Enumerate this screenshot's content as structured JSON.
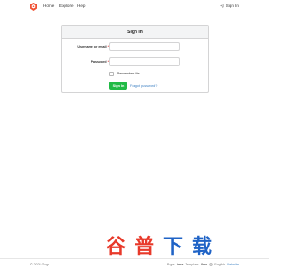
{
  "navbar": {
    "links": [
      "Home",
      "Explore",
      "Help"
    ],
    "signin": "Sign In",
    "logo_icon": "gogs-logo",
    "signin_icon": "sign-in-icon"
  },
  "login": {
    "title": "Sign In",
    "username_label": "Username or email",
    "username_value": "",
    "password_label": "Password",
    "password_value": "",
    "required_mark": "*",
    "remember_label": "Remember Me",
    "remember_checked": false,
    "signin_button": "Sign In",
    "forgot_link": "Forgot password?"
  },
  "footer": {
    "copyright": "© 2024 Gogs",
    "page_label": "Page:",
    "page_value": "0ms",
    "template_label": "Template:",
    "template_value": "0ms",
    "language": "English",
    "website": "Website"
  },
  "watermark_text": "谷普下载",
  "colors": {
    "accent_green": "#21ba45",
    "link_blue": "#4183c4",
    "logo_red": "#f05133",
    "watermark_red": "#e8392a",
    "watermark_blue": "#1f63c6"
  }
}
